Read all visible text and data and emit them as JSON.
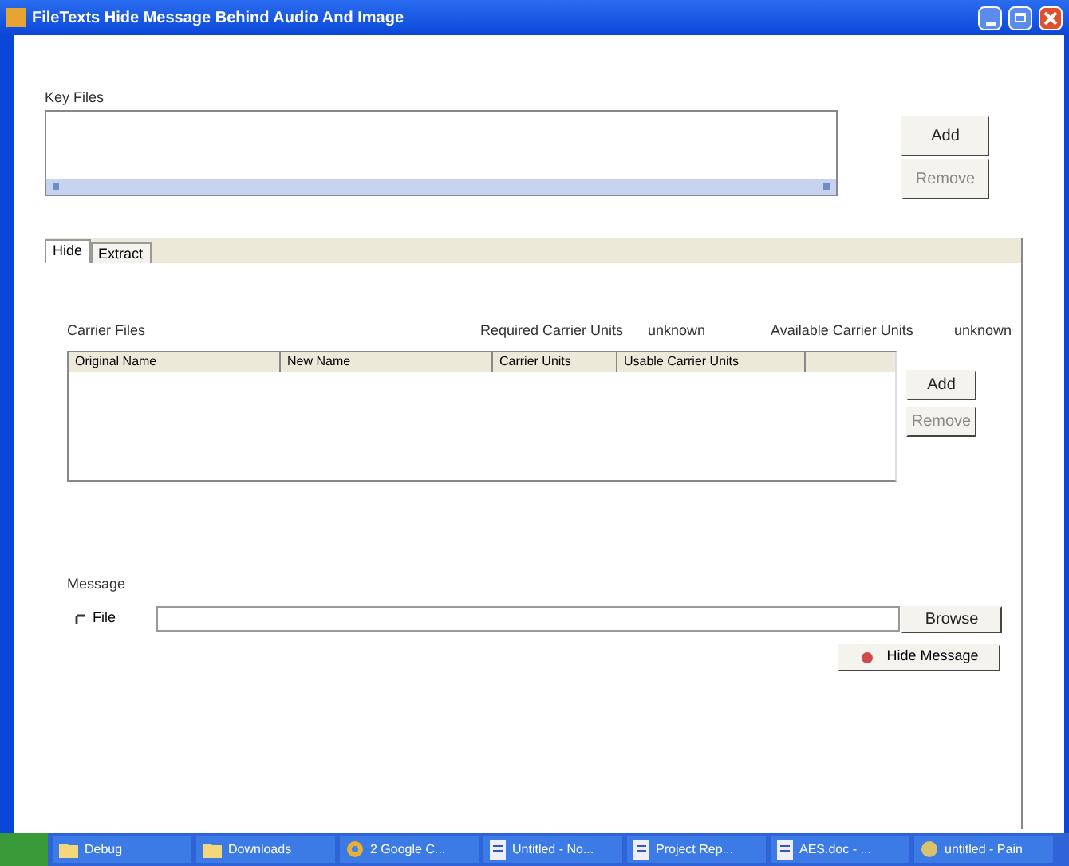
{
  "window": {
    "title": "FileTexts Hide Message Behind Audio And Image"
  },
  "key_files": {
    "label": "Key Files",
    "buttons": [
      "Add",
      "Remove"
    ]
  },
  "tabs": [
    {
      "label": "Hide",
      "selected": true
    },
    {
      "label": "Extract",
      "selected": false
    }
  ],
  "carrier": {
    "label": "Carrier Files",
    "required_label": "Required Carrier Units",
    "required_value": "unknown",
    "available_label": "Available Carrier Units",
    "available_value": "unknown",
    "columns": [
      "Original Name",
      "New Name",
      "Carrier Units",
      "Usable Carrier Units"
    ],
    "buttons": [
      "Add",
      "Remove"
    ]
  },
  "message": {
    "label": "Message",
    "file_option": {
      "label": "File",
      "checked": true
    },
    "browse_button": "Browse",
    "hide_button": "Hide Message"
  },
  "taskbar": [
    {
      "label": "Debug",
      "kind": "folder"
    },
    {
      "label": "Downloads",
      "kind": "folder"
    },
    {
      "label": "2 Google C...",
      "kind": "browser"
    },
    {
      "label": "Untitled - No...",
      "kind": "doc"
    },
    {
      "label": "Project Rep...",
      "kind": "doc"
    },
    {
      "label": "AES.doc - ...",
      "kind": "doc"
    },
    {
      "label": "untitled - Pain",
      "kind": "paint"
    }
  ]
}
